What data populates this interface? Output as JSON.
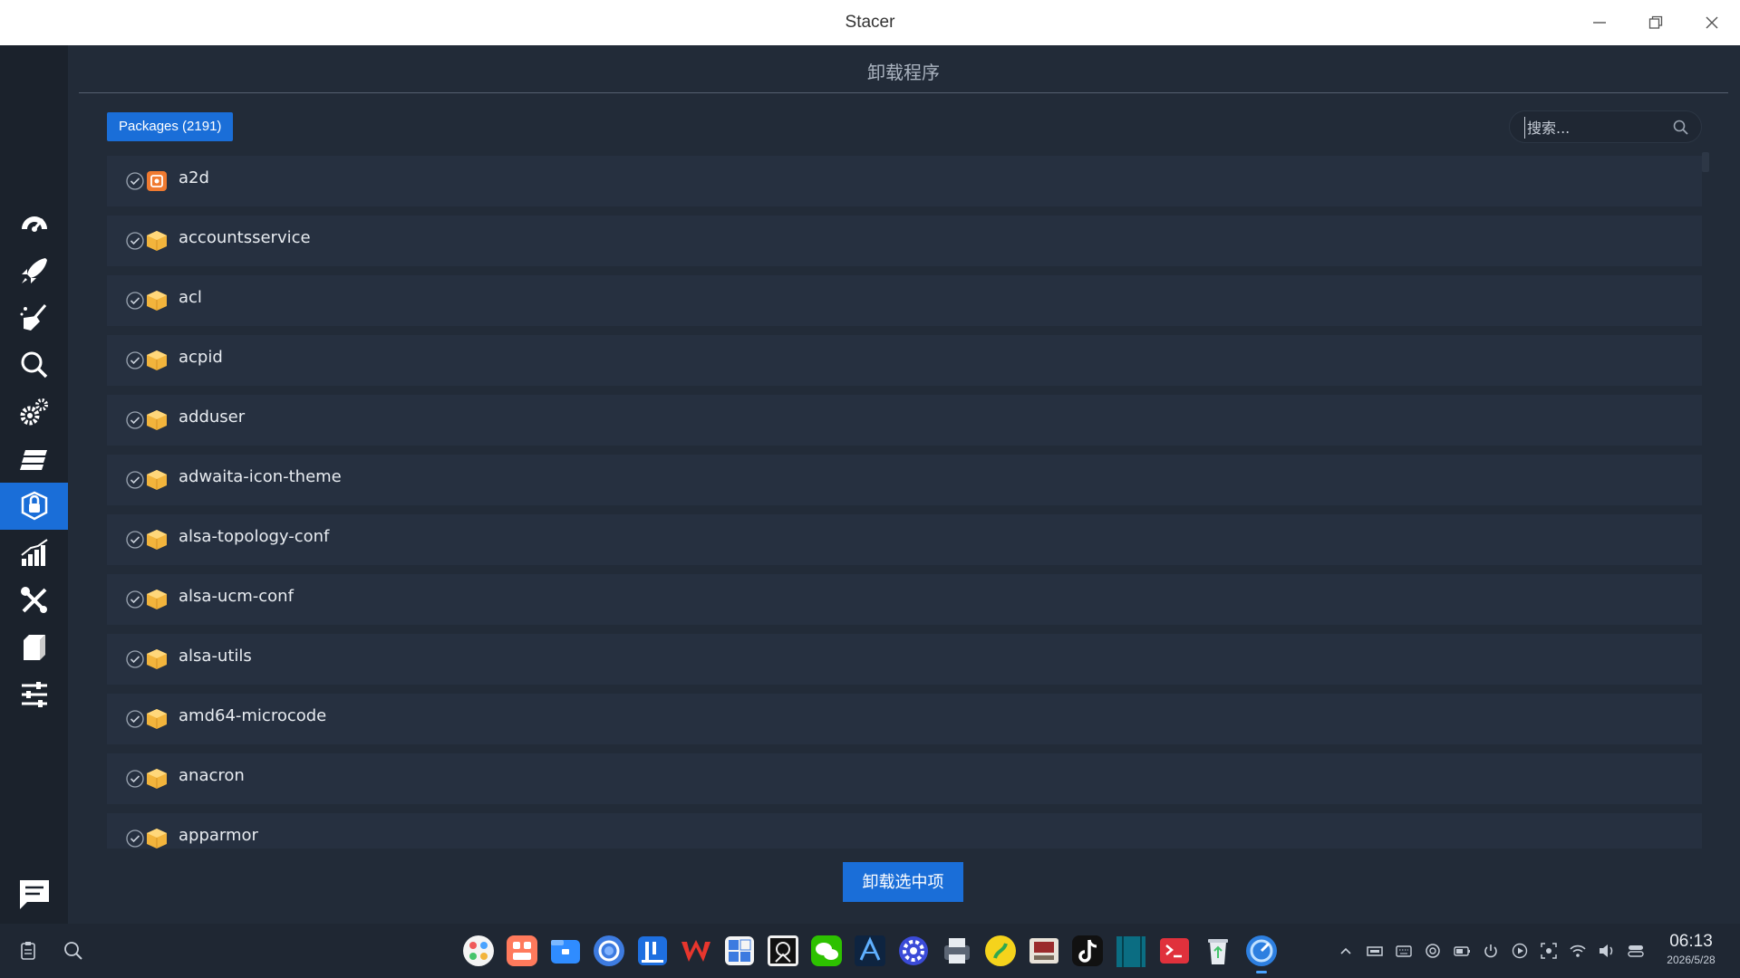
{
  "window": {
    "title": "Stacer"
  },
  "page": {
    "heading": "卸载程序"
  },
  "packages_badge": "Packages (2191)",
  "search": {
    "placeholder": "搜索..."
  },
  "packages": [
    {
      "name": "a2d",
      "icon": "app-icon"
    },
    {
      "name": "accountsservice",
      "icon": "package-icon"
    },
    {
      "name": "acl",
      "icon": "package-icon"
    },
    {
      "name": "acpid",
      "icon": "package-icon"
    },
    {
      "name": "adduser",
      "icon": "package-icon"
    },
    {
      "name": "adwaita-icon-theme",
      "icon": "package-icon"
    },
    {
      "name": "alsa-topology-conf",
      "icon": "package-icon"
    },
    {
      "name": "alsa-ucm-conf",
      "icon": "package-icon"
    },
    {
      "name": "alsa-utils",
      "icon": "package-icon"
    },
    {
      "name": "amd64-microcode",
      "icon": "package-icon"
    },
    {
      "name": "anacron",
      "icon": "package-icon"
    },
    {
      "name": "apparmor",
      "icon": "package-icon"
    }
  ],
  "uninstall_label": "卸载选中项",
  "sidebar": {
    "items": [
      {
        "name": "dashboard",
        "icon": "speedometer-icon"
      },
      {
        "name": "startup-apps",
        "icon": "rocket-icon"
      },
      {
        "name": "system-cleaner",
        "icon": "broom-icon"
      },
      {
        "name": "search",
        "icon": "search-icon"
      },
      {
        "name": "services",
        "icon": "gears-icon"
      },
      {
        "name": "processes",
        "icon": "stack-icon"
      },
      {
        "name": "uninstaller",
        "icon": "package-lock-icon",
        "active": true
      },
      {
        "name": "resources",
        "icon": "bar-chart-icon"
      },
      {
        "name": "helpers",
        "icon": "tools-icon"
      },
      {
        "name": "apt-repository",
        "icon": "box-icon"
      },
      {
        "name": "settings",
        "icon": "sliders-icon"
      }
    ],
    "feedback_icon": "feedback-icon"
  },
  "clock": {
    "time": "06:13",
    "date": "2026/5/28"
  },
  "colors": {
    "accent": "#1a6ed8",
    "background": "#222b38",
    "row": "#263040",
    "sidebar": "#1b222c"
  }
}
